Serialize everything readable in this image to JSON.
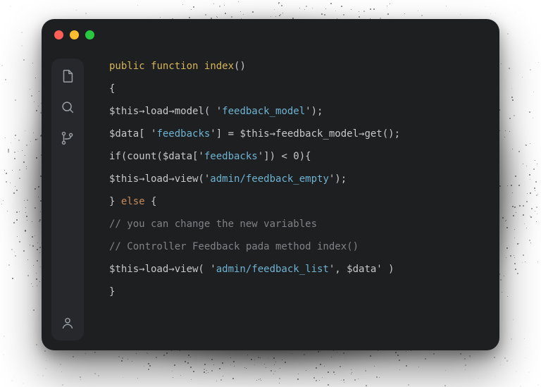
{
  "traffic": {
    "red": "#ff5f57",
    "yellow": "#febc2e",
    "green": "#28c840"
  },
  "sidebar": {
    "items": [
      {
        "name": "file-icon"
      },
      {
        "name": "search-icon"
      },
      {
        "name": "git-branch-icon"
      }
    ],
    "footer": {
      "name": "account-icon"
    }
  },
  "code": {
    "lines": [
      {
        "kind": "sig",
        "parts": {
          "kw1": "public",
          "kw2": "function",
          "fn": "index",
          "paren": "()"
        }
      },
      {
        "kind": "plain",
        "text": "{"
      },
      {
        "kind": "call1",
        "parts": {
          "pre": "$this→load→model( '",
          "str": "feedback_model",
          "post": "');"
        }
      },
      {
        "kind": "assign",
        "parts": {
          "pre": "$data[ '",
          "str": "feedbacks",
          "mid": "'] = $this→feedback_model→get();"
        }
      },
      {
        "kind": "if",
        "parts": {
          "pre": "if(count($data['",
          "str": "feedbacks",
          "post": "']) < 0){"
        }
      },
      {
        "kind": "call1",
        "parts": {
          "pre": "$this→load→view('",
          "str": "admin/feedback_empty",
          "post": "');"
        }
      },
      {
        "kind": "else",
        "parts": {
          "close": "} ",
          "kw": "else",
          "open": " {"
        }
      },
      {
        "kind": "cmt",
        "text": "// you can change the new variables"
      },
      {
        "kind": "cmt",
        "text": "// Controller Feedback pada method index()"
      },
      {
        "kind": "call2",
        "parts": {
          "pre": "$this→load→view( '",
          "str": "admin/feedback_list",
          "post": "', $data' )"
        }
      },
      {
        "kind": "plain",
        "text": "}"
      }
    ]
  }
}
